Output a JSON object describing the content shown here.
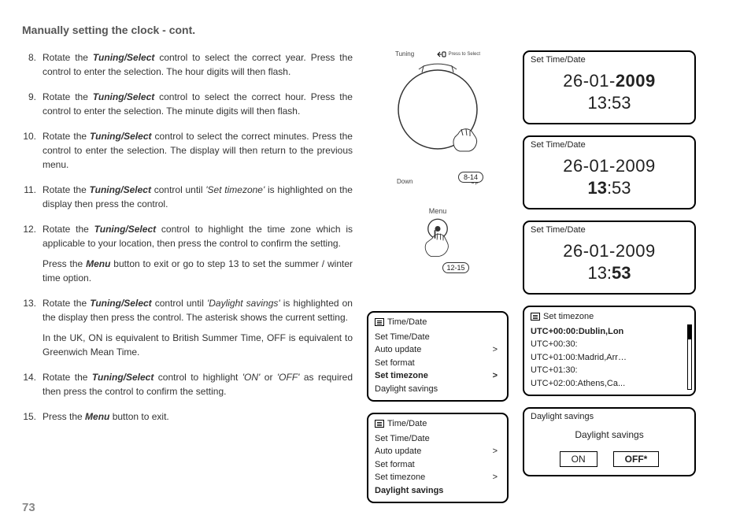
{
  "title": "Manually setting the clock - cont.",
  "page_number": "73",
  "steps": {
    "8": {
      "num": "8.",
      "pre": "Rotate the ",
      "ctrl": "Tuning/Select",
      "post": " control to select the correct year. Press the control to enter the selection. The hour digits will then flash."
    },
    "9": {
      "num": "9.",
      "pre": "Rotate the ",
      "ctrl": "Tuning/Select",
      "post": " control to select the correct hour. Press the control to enter the selection. The minute digits will then flash."
    },
    "10": {
      "num": "10.",
      "pre": "Rotate the ",
      "ctrl": "Tuning/Select",
      "post": " control to select the correct minutes. Press the control to enter the selection.  The display will then return to the previous menu."
    },
    "11": {
      "num": "11.",
      "pre": "Rotate the ",
      "ctrl": "Tuning/Select",
      "mid": " control until ",
      "opt": "'Set timezone'",
      "post": " is highlighted on the display then press the control."
    },
    "12": {
      "num": "12.",
      "pre": "Rotate the ",
      "ctrl": "Tuning/Select",
      "post": " control to highlight the time zone which is applicable to your location, then press the control to confirm the setting.",
      "sub_pre": "Press the ",
      "sub_btn": "Menu",
      "sub_post": " button to exit or go to step 13 to set the summer / winter time option."
    },
    "13": {
      "num": "13.",
      "pre": "Rotate the ",
      "ctrl": "Tuning/Select",
      "mid": " control until ",
      "opt": "'Daylight savings'",
      "post": " is highlighted on the display then press the control. The asterisk shows the current setting.",
      "sub": "In the UK, ON is equivalent to British Summer Time, OFF is equivalent to Greenwich Mean Time."
    },
    "14": {
      "num": "14.",
      "pre": "Rotate the ",
      "ctrl": "Tuning/Select",
      "mid": " control to highlight ",
      "opt1": "'ON'",
      "or": " or ",
      "opt2": "'OFF'",
      "post": " as required then press the control to confirm the setting."
    },
    "15": {
      "num": "15.",
      "pre": "Press the ",
      "btn": "Menu",
      "post": " button to exit."
    }
  },
  "dial": {
    "top": "Tuning",
    "press": "Press to Select",
    "down": "Down",
    "up": "Up",
    "range": "8-14",
    "menu_label": "Menu",
    "range2": "12-15"
  },
  "lcd": {
    "header": "Set Time/Date",
    "year": {
      "date_pre": "26-01-",
      "date_bold": "2009",
      "time": "13:53"
    },
    "hour": {
      "date": "26-01-2009",
      "time_bold": "13",
      "time_rest": ":53"
    },
    "minute": {
      "date": "26-01-2009",
      "time_pre": "13:",
      "time_bold": "53"
    }
  },
  "menu_timedate": {
    "title": "Time/Date",
    "r1": "Set Time/Date",
    "r2": "Auto update",
    "r3": "Set format",
    "r4": "Set timezone",
    "r5": "Daylight savings",
    "chev": ">"
  },
  "menu_tz": {
    "title": "Set timezone",
    "r1": "UTC+00:00:Dublin,Lon",
    "r2": "UTC+00:30:",
    "r3": "UTC+01:00:Madrid,Arr…",
    "r4": "UTC+01:30:",
    "r5": "UTC+02:00:Athens,Ca..."
  },
  "ds": {
    "title": "Daylight savings",
    "label": "Daylight savings",
    "on": "ON",
    "off": "OFF*"
  }
}
